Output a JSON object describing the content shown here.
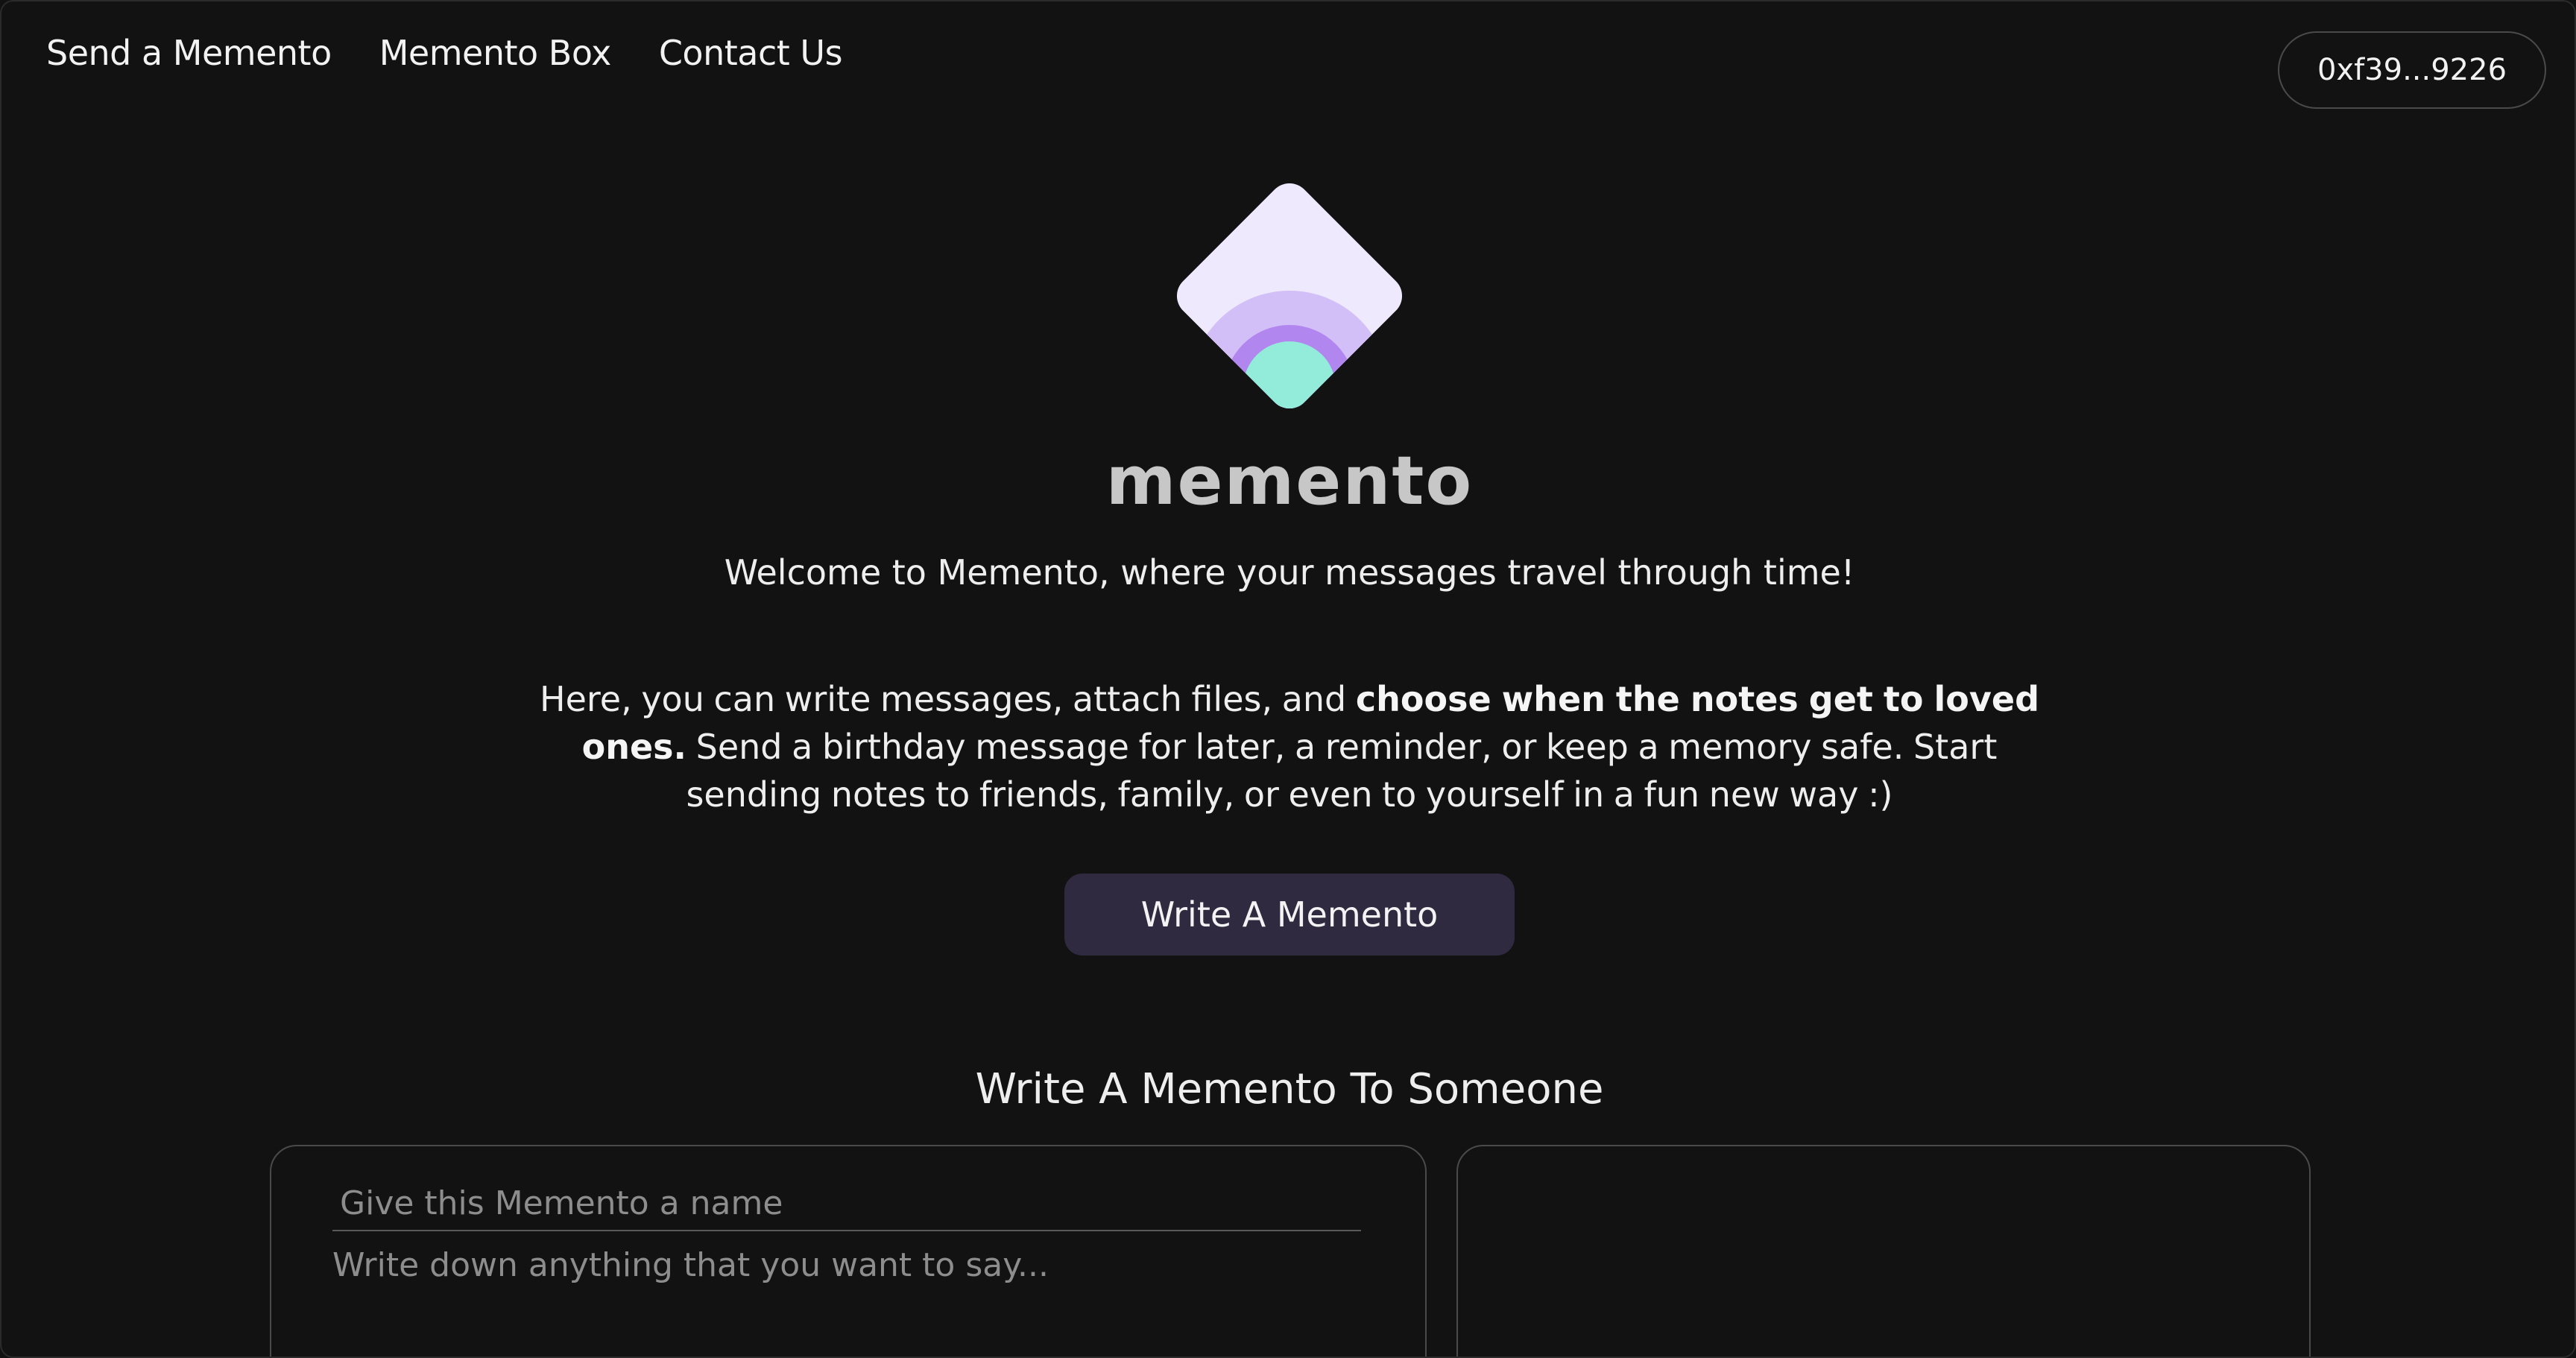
{
  "nav": {
    "links": [
      "Send a Memento",
      "Memento Box",
      "Contact Us"
    ]
  },
  "wallet": {
    "address": "0xf39...9226"
  },
  "brand": {
    "name": "memento",
    "colors": {
      "light": "#efe9fd",
      "lavender": "#d3bff7",
      "purple": "#b186ef",
      "mint": "#93ecda"
    }
  },
  "hero": {
    "welcome": "Welcome to Memento, where your messages travel through time!",
    "intro_pre": "Here, you can write messages, attach files, and ",
    "intro_bold": "choose when the notes get to loved ones.",
    "intro_post": " Send a birthday message for later, a reminder, or keep a memory safe. Start sending notes to friends, family, or even to yourself in a fun new way :)",
    "cta_label": "Write A Memento"
  },
  "compose": {
    "title": "Write A Memento To Someone",
    "name_placeholder": "Give this Memento a name",
    "message_placeholder": "Write down anything that you want to say..."
  },
  "colors": {
    "background": "#121212",
    "button": "#302a40",
    "border": "#4a4a4a"
  }
}
